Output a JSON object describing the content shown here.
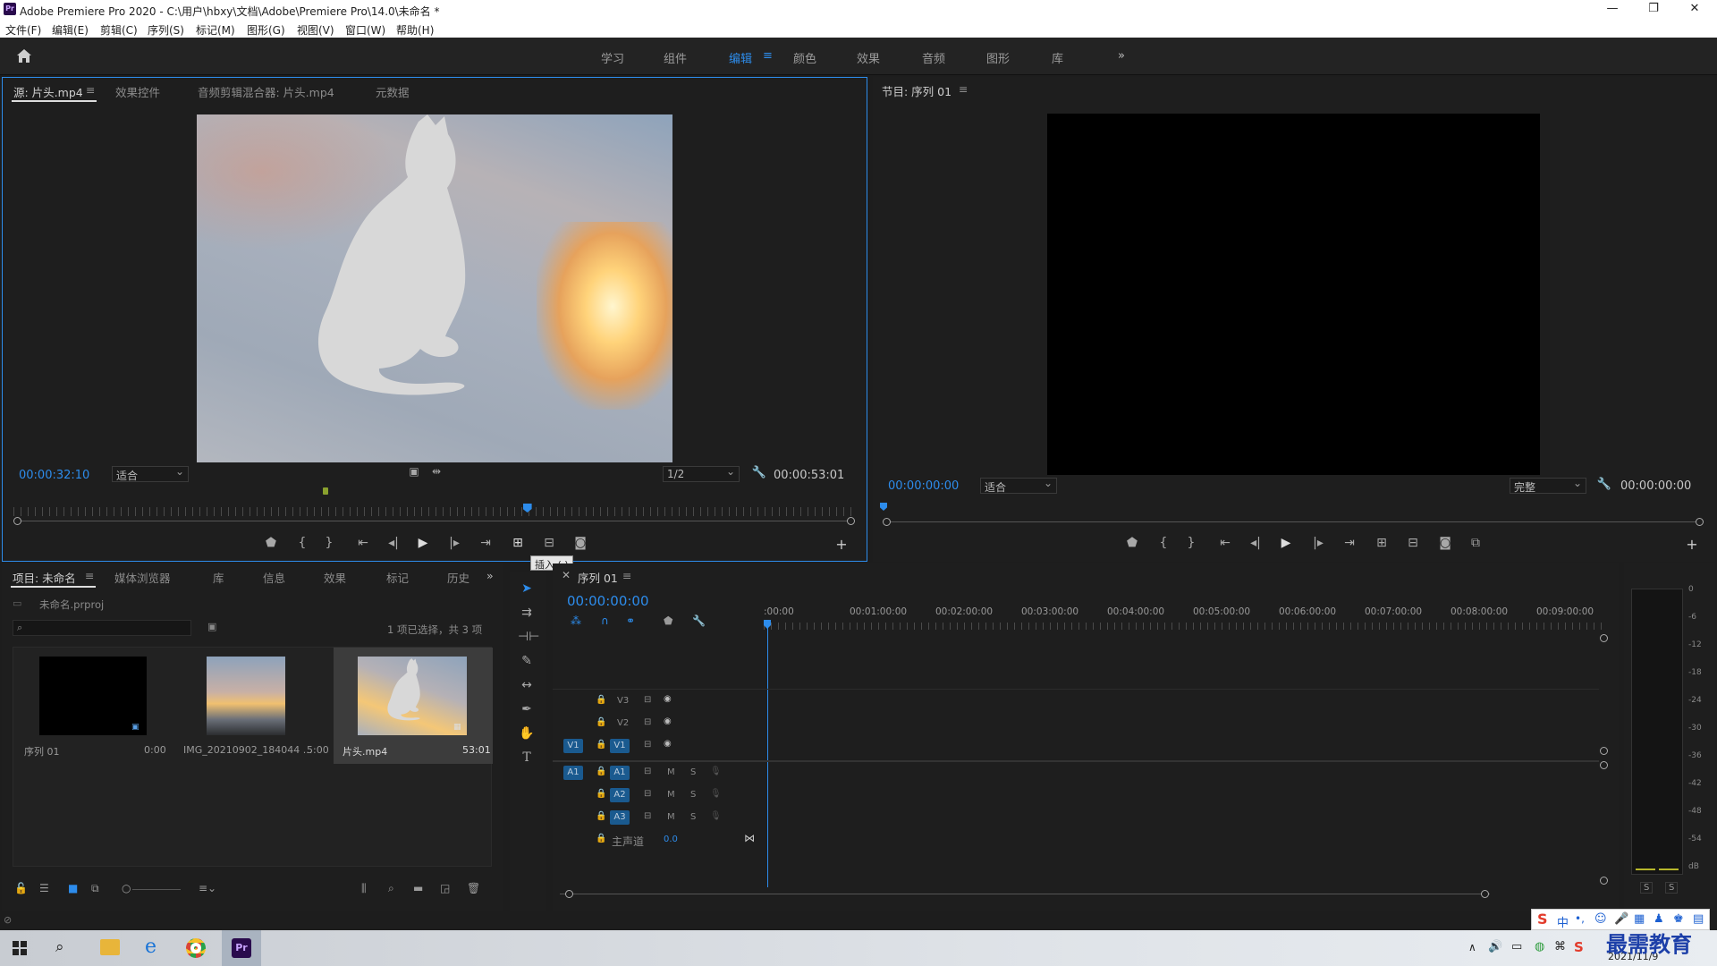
{
  "window": {
    "title": "Adobe Premiere Pro 2020 - C:\\用户\\hbxy\\文档\\Adobe\\Premiere Pro\\14.0\\未命名 *",
    "logo": "Pr"
  },
  "menu": [
    "文件(F)",
    "编辑(E)",
    "剪辑(C)",
    "序列(S)",
    "标记(M)",
    "图形(G)",
    "视图(V)",
    "窗口(W)",
    "帮助(H)"
  ],
  "workspaces": [
    "学习",
    "组件",
    "编辑",
    "颜色",
    "效果",
    "音频",
    "图形",
    "库"
  ],
  "active_workspace": "编辑",
  "source_panel": {
    "tabs": [
      "源: 片头.mp4",
      "效果控件",
      "音频剪辑混合器: 片头.mp4",
      "元数据"
    ],
    "timecode": "00:00:32:10",
    "fit": "适合",
    "resolution": "1/2",
    "duration": "00:00:53:01",
    "playhead_fraction": 0.61,
    "tooltip": "插入 (,)"
  },
  "program_panel": {
    "title": "节目: 序列 01",
    "timecode": "00:00:00:00",
    "fit": "适合",
    "quality": "完整",
    "duration": "00:00:00:00"
  },
  "project_panel": {
    "tabs": [
      "项目: 未命名",
      "媒体浏览器",
      "库",
      "信息",
      "效果",
      "标记",
      "历史"
    ],
    "project_file": "未命名.prproj",
    "selection_info": "1 项已选择，共 3 项",
    "items": [
      {
        "name": "序列 01",
        "duration": "0:00"
      },
      {
        "name": "IMG_20210902_184044 ...",
        "duration": "5:00"
      },
      {
        "name": "片头.mp4",
        "duration": "53:01"
      }
    ]
  },
  "timeline": {
    "title": "序列 01",
    "timecode": "00:00:00:00",
    "ruler": [
      ":00:00",
      "00:01:00:00",
      "00:02:00:00",
      "00:03:00:00",
      "00:04:00:00",
      "00:05:00:00",
      "00:06:00:00",
      "00:07:00:00",
      "00:08:00:00",
      "00:09:00:00"
    ],
    "video_tracks": [
      "V3",
      "V2",
      "V1"
    ],
    "audio_tracks": [
      "A1",
      "A2",
      "A3"
    ],
    "source_v": "V1",
    "source_a": "A1",
    "master_label": "主声道",
    "master_value": "0.0",
    "mute": "M",
    "solo": "S"
  },
  "audio_meter": {
    "scale": [
      "0",
      "-6",
      "-12",
      "-18",
      "-24",
      "-30",
      "-36",
      "-42",
      "-48",
      "-54",
      "dB"
    ],
    "solo": [
      "S",
      "S"
    ]
  },
  "taskbar": {
    "date": "2021/11/9",
    "ime": "中",
    "watermark": "最需教育"
  },
  "colors": {
    "accent": "#2d8ceb",
    "panel_bg": "#1e1e1e",
    "track_badge": "#1a5a8f"
  }
}
